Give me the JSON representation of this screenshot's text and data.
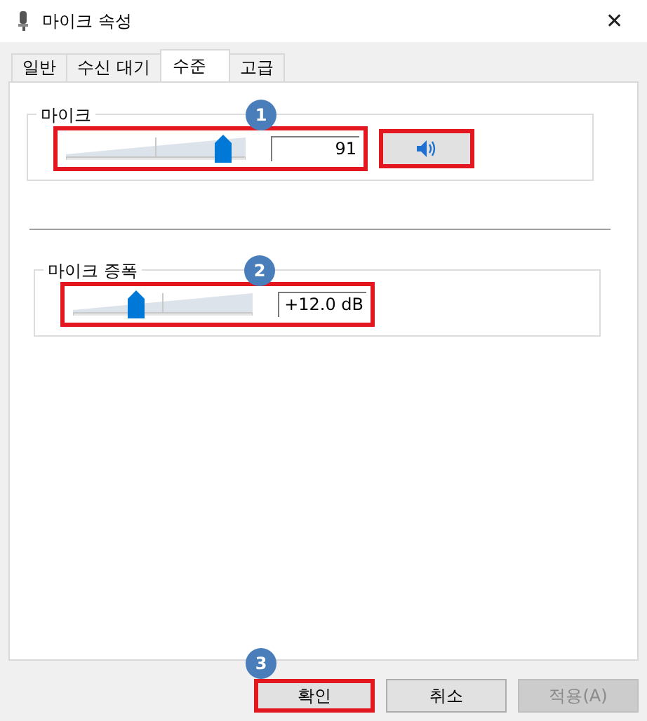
{
  "window": {
    "title": "마이크 속성",
    "close": "✕"
  },
  "tabs": [
    {
      "label": "일반",
      "selected": false
    },
    {
      "label": "수신 대기",
      "selected": false
    },
    {
      "label": "수준",
      "selected": true
    },
    {
      "label": "고급",
      "selected": false
    }
  ],
  "groups": [
    {
      "title": "마이크",
      "slider": {
        "level": 0.91
      },
      "value": "91",
      "highlighted": true,
      "badge": "1",
      "mute_button": {
        "highlighted": true
      }
    },
    {
      "title": "마이크 증폭",
      "slider": {
        "level": 0.34
      },
      "value": "+12.0 dB",
      "highlighted": true,
      "badge": "2"
    }
  ],
  "buttons": [
    {
      "label": "확인",
      "disabled": false,
      "highlighted": true,
      "badge": "3"
    },
    {
      "label": "취소",
      "disabled": false,
      "highlighted": false
    },
    {
      "label": "적용(A)",
      "disabled": true,
      "highlighted": false
    }
  ]
}
